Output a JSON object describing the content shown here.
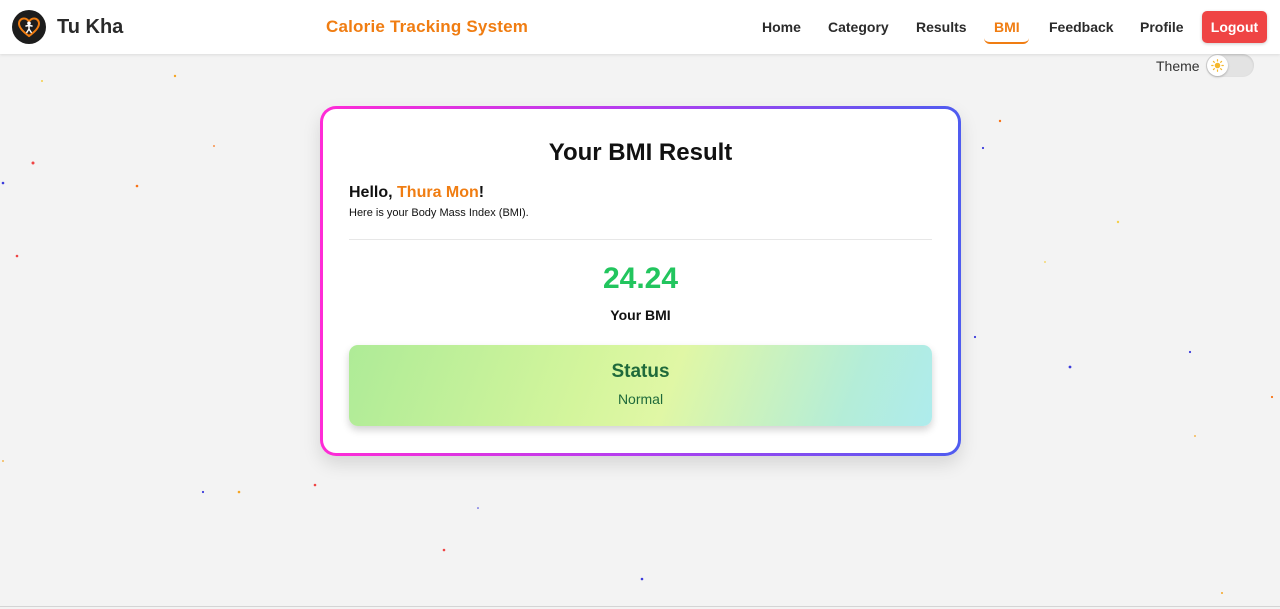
{
  "brand": {
    "name": "Tu Kha",
    "logo_icon": "heart-person-logo-icon"
  },
  "header": {
    "site_title": "Calorie Tracking System"
  },
  "nav": {
    "items": [
      {
        "label": "Home"
      },
      {
        "label": "Category"
      },
      {
        "label": "Results"
      },
      {
        "label": "BMI",
        "active": true
      },
      {
        "label": "Feedback"
      },
      {
        "label": "Profile"
      }
    ],
    "logout_label": "Logout"
  },
  "theme": {
    "label": "Theme",
    "icon": "sun-icon",
    "enabled": false
  },
  "card": {
    "title": "Your BMI Result",
    "greeting_prefix": "Hello, ",
    "user_name": "Thura Mon",
    "greeting_suffix": "!",
    "subtext": "Here is your Body Mass Index (BMI).",
    "bmi_value": "24.24",
    "bmi_label": "Your BMI",
    "status_title": "Status",
    "status_value": "Normal"
  },
  "colors": {
    "accent": "#f07d12",
    "bmi_value": "#22c55e",
    "logout": "#ef4444",
    "status_text": "#1f6a3b"
  }
}
